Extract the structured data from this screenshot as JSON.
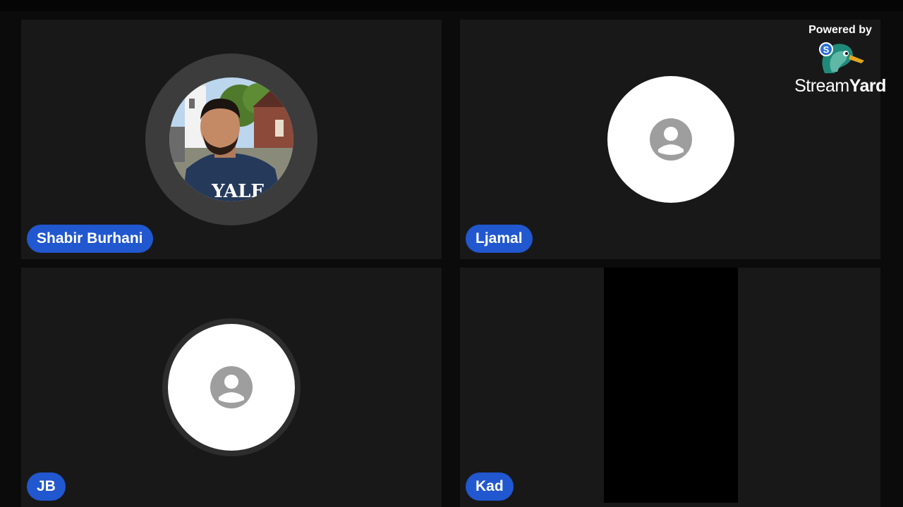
{
  "watermark": {
    "powered_by": "Powered by",
    "brand_part1": "Stream",
    "brand_part2": "Yard",
    "logo_icon": "streamyard-duck-icon"
  },
  "participants": [
    {
      "name": "Shabir Burhani",
      "avatar": "photo",
      "shirt_text": "YALE",
      "speaking": true
    },
    {
      "name": "Ljamal",
      "avatar": "person-icon"
    },
    {
      "name": "JB",
      "avatar": "person-icon"
    },
    {
      "name": "Kad",
      "avatar": "video-black"
    }
  ],
  "colors": {
    "name_tag_bg": "#2157cf",
    "tile_bg": "#181818",
    "page_bg": "#0b0b0b"
  }
}
